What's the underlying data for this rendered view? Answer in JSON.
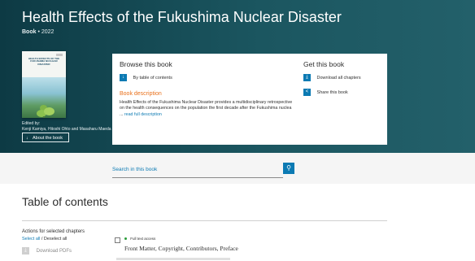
{
  "header": {
    "title": "Health Effects of the Fukushima Nuclear Disaster",
    "type": "Book",
    "separator": "•",
    "year": "2022"
  },
  "cover": {
    "title": "HEALTH EFFECTS OF THE FUKUSHIMA NUCLEAR DISASTER"
  },
  "editors": {
    "label": "Edited by:",
    "names": "Kenji Kamiya, Hitoshi Ohto and Masaharu Maeda"
  },
  "about_button": {
    "icon": "↓",
    "label": "About the book"
  },
  "browse": {
    "heading": "Browse this book",
    "toc_icon": "↓",
    "toc_label": "By table of contents"
  },
  "description": {
    "heading": "Book description",
    "text": "Health Effects of the Fukushima Nuclear Disaster provides a multidisciplinary retrospective on the health consequences on the population the first decade after the Fukushima nuclea ...",
    "read_more": "read full description"
  },
  "get": {
    "heading": "Get this book",
    "download_icon": "⤓",
    "download_label": "Download all chapters",
    "share_icon": "<",
    "share_label": "Share this book"
  },
  "search": {
    "placeholder": "Search in this book",
    "icon": "⚲"
  },
  "toc": {
    "title": "Table of contents"
  },
  "actions": {
    "heading": "Actions for selected chapters",
    "select_all": "Select all",
    "divider": "/",
    "deselect_all": "Deselect all",
    "pdf_icon": "⤓",
    "download_pdfs": "Download PDFs"
  },
  "chapters": [
    {
      "access": "Full text access",
      "title": "Front Matter, Copyright, Contributors, Preface"
    }
  ],
  "colors": {
    "hero_dark": "#0d3a44",
    "hero_light": "#23606a",
    "accent_blue": "#0c7ab3",
    "accent_orange": "#e9711c",
    "access_green": "#2a9d3a"
  }
}
